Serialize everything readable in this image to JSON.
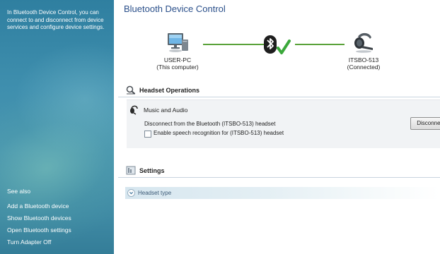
{
  "sidebar": {
    "intro": "In Bluetooth Device Control, you can connect to and disconnect from device services and configure device settings.",
    "see_also_title": "See also",
    "links": [
      "Add a Bluetooth device",
      "Show Bluetooth devices",
      "Open Bluetooth settings",
      "Turn Adapter Off"
    ]
  },
  "main": {
    "title": "Bluetooth Device Control",
    "computer": {
      "name": "USER-PC",
      "sub": "(This computer)",
      "icon": "computer-icon"
    },
    "device": {
      "name": "ITSBO-513",
      "sub": "(Connected)",
      "icon": "headset-icon"
    },
    "connection_icon": "bluetooth-connected-icon",
    "headset_operations": {
      "header": "Headset Operations",
      "service": "Music and Audio",
      "description": "Disconnect from the Bluetooth (ITSBO-513) headset",
      "checkbox_label": "Enable speech recognition for (ITSBO-513) headset",
      "checkbox_checked": false,
      "button": "Disconnect"
    },
    "settings": {
      "header": "Settings",
      "headset_type": "Headset type"
    }
  },
  "colors": {
    "sidebar": "#3f8fae",
    "title": "#2a4f8a",
    "connection_line": "#5aa23a",
    "check_mark": "#3aa83a"
  }
}
